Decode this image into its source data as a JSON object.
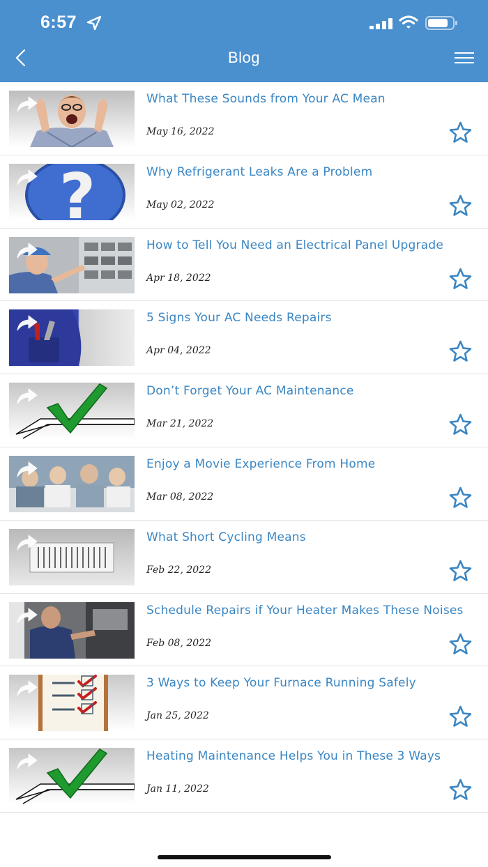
{
  "status_bar": {
    "time": "6:57"
  },
  "header": {
    "title": "Blog"
  },
  "posts": [
    {
      "title": "What These Sounds from Your AC Mean",
      "date": "May 16, 2022",
      "thumb": "excited-man"
    },
    {
      "title": "Why Refrigerant Leaks Are a Problem",
      "date": "May 02, 2022",
      "thumb": "question-mark"
    },
    {
      "title": "How to Tell You Need an Electrical Panel Upgrade",
      "date": "Apr 18, 2022",
      "thumb": "electrician"
    },
    {
      "title": "5 Signs Your AC Needs Repairs",
      "date": "Apr 04, 2022",
      "thumb": "tools-pocket"
    },
    {
      "title": "Don’t Forget Your AC Maintenance",
      "date": "Mar 21, 2022",
      "thumb": "checkmark"
    },
    {
      "title": "Enjoy a Movie Experience From Home",
      "date": "Mar 08, 2022",
      "thumb": "family-couch"
    },
    {
      "title": "What Short Cycling Means",
      "date": "Feb 22, 2022",
      "thumb": "air-vent"
    },
    {
      "title": "Schedule Repairs if Your Heater Makes These Noises",
      "date": "Feb 08, 2022",
      "thumb": "technician"
    },
    {
      "title": "3 Ways to Keep Your Furnace Running Safely",
      "date": "Jan 25, 2022",
      "thumb": "checklist"
    },
    {
      "title": "Heating Maintenance Helps You in These 3 Ways",
      "date": "Jan 11, 2022",
      "thumb": "checkmark"
    }
  ],
  "colors": {
    "header_bg": "#4a8fce",
    "link": "#3a86c3",
    "star": "#3a86c3"
  }
}
